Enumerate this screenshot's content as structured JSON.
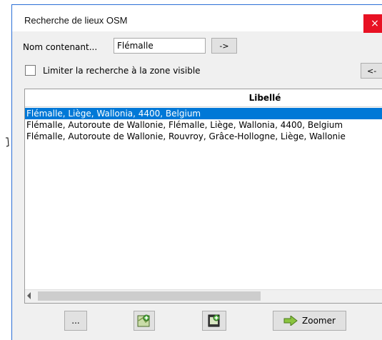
{
  "window": {
    "title": "Recherche de lieux OSM",
    "close_glyph": "×"
  },
  "search": {
    "label": "Nom contenant...",
    "value": "Flémalle",
    "go_label": "->"
  },
  "limit": {
    "label": "Limiter la recherche à la zone visible",
    "checked": false,
    "back_label": "<-"
  },
  "results": {
    "column": "Libellé",
    "rows": [
      "Flémalle, Liège, Wallonia, 4400, Belgium",
      "Flémalle, Autoroute de Wallonie, Flémalle, Liège, Wallonia, 4400, Belgium",
      "Flémalle, Autoroute de Wallonie, Rouvroy, Grâce-Hollogne, Liège, Wallonie"
    ],
    "selected_index": 0
  },
  "buttons": {
    "more_label": "...",
    "zoom_label": "Zoomer",
    "place_icon": "map-pin-add-icon",
    "bbox_icon": "map-area-add-icon",
    "zoom_icon": "green-arrow-icon"
  },
  "colors": {
    "close_red": "#e81123",
    "selection_blue": "#0078d7",
    "accent_green": "#4caf3c"
  }
}
